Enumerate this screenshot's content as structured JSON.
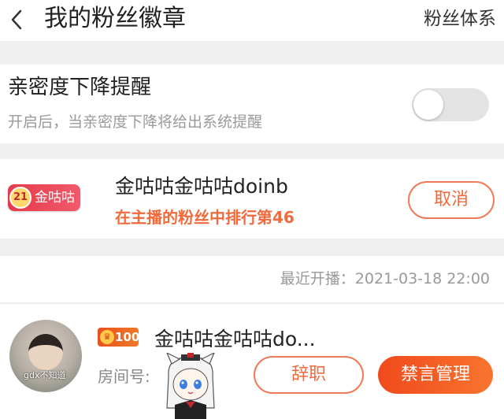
{
  "header": {
    "title": "我的粉丝徽章",
    "right_link": "粉丝体系"
  },
  "notify": {
    "title": "亲密度下降提醒",
    "subtitle": "开启后，当亲密度下降将给出系统提醒",
    "toggle_on": false
  },
  "badge_card": {
    "badge_level": "21",
    "badge_name": "金咕咕",
    "streamer_name": "金咕咕金咕咕doinb",
    "rank_text": "在主播的粉丝中排行第46",
    "cancel_label": "取消"
  },
  "live": {
    "last_live": "最近开播：2021-03-18 22:00"
  },
  "manager_card": {
    "avatar_caption": "gdx不知道",
    "level_badge": "100",
    "name": "金咕咕金咕咕do...",
    "room_label": "房间号:",
    "resign_label": "辞职",
    "mute_label": "禁言管理"
  },
  "colors": {
    "accent": "#f06a3c",
    "badge_red": "#e63a4a"
  }
}
